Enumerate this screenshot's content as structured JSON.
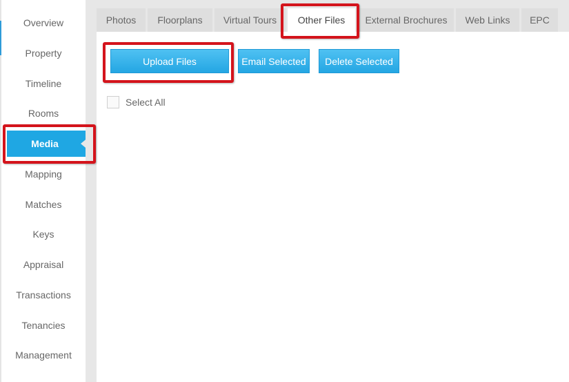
{
  "sidebar": {
    "items": [
      {
        "label": "Overview"
      },
      {
        "label": "Property"
      },
      {
        "label": "Timeline"
      },
      {
        "label": "Rooms"
      },
      {
        "label": "Media",
        "active": true
      },
      {
        "label": "Mapping"
      },
      {
        "label": "Matches"
      },
      {
        "label": "Keys"
      },
      {
        "label": "Appraisal"
      },
      {
        "label": "Transactions"
      },
      {
        "label": "Tenancies"
      },
      {
        "label": "Management"
      }
    ]
  },
  "tabs": [
    {
      "label": "Photos"
    },
    {
      "label": "Floorplans"
    },
    {
      "label": "Virtual Tours"
    },
    {
      "label": "Other Files",
      "active": true
    },
    {
      "label": "External Brochures"
    },
    {
      "label": "Web Links"
    },
    {
      "label": "EPC"
    }
  ],
  "toolbar": {
    "upload_label": "Upload Files",
    "email_label": "Email Selected",
    "delete_label": "Delete Selected"
  },
  "select_all": {
    "label": "Select All",
    "checked": false
  },
  "colors": {
    "accent": "#1fa7e3",
    "highlight": "#d4141c",
    "tab_bar": "#e7e7e7"
  }
}
